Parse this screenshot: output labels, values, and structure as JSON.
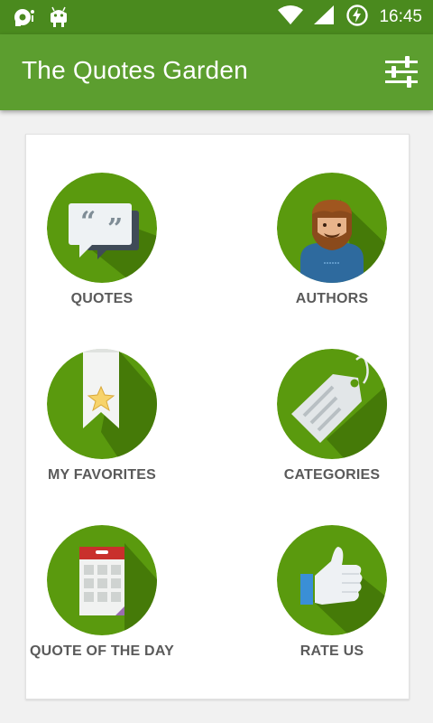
{
  "status_bar": {
    "time": "16:45",
    "icons": [
      "sync-ghost-icon",
      "android-icon",
      "wifi-icon",
      "signal-icon",
      "battery-charging-icon"
    ]
  },
  "app_bar": {
    "title": "The Quotes Garden",
    "settings_icon": "sliders-icon"
  },
  "menu": {
    "items": [
      {
        "id": "quotes",
        "label": "QUOTES",
        "icon": "speech-bubbles-icon"
      },
      {
        "id": "authors",
        "label": "AUTHORS",
        "icon": "bearded-man-icon"
      },
      {
        "id": "favorites",
        "label": "MY FAVORITES",
        "icon": "bookmark-star-icon"
      },
      {
        "id": "categories",
        "label": "CATEGORIES",
        "icon": "price-tag-icon"
      },
      {
        "id": "quote-of-the-day",
        "label": "QUOTE OF THE DAY",
        "icon": "calendar-icon"
      },
      {
        "id": "rate-us",
        "label": "RATE US",
        "icon": "thumbs-up-icon"
      }
    ]
  },
  "colors": {
    "status_bar": "#4a8a1e",
    "app_bar": "#5c9e2f",
    "circle": "#5a9a0e",
    "circle_shadow": "#457a08",
    "label": "#5a5a5a",
    "background": "#f1f1f1"
  }
}
